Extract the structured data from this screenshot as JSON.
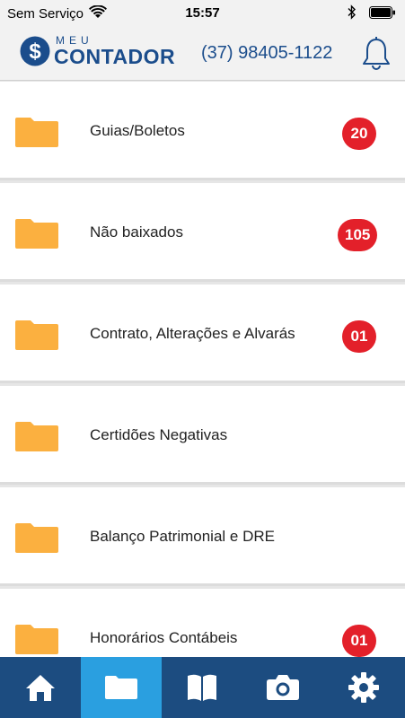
{
  "status_bar": {
    "carrier": "Sem Serviço",
    "time": "15:57"
  },
  "header": {
    "logo_small": "MEU",
    "logo_large": "CONTADOR",
    "phone": "(37) 98405-1122"
  },
  "folders": [
    {
      "label": "Guias/Boletos",
      "badge": "20"
    },
    {
      "label": "Não baixados",
      "badge": "105"
    },
    {
      "label": "Contrato, Alterações e Alvarás",
      "badge": "01"
    },
    {
      "label": "Certidões Negativas",
      "badge": ""
    },
    {
      "label": "Balanço Patrimonial e DRE",
      "badge": ""
    },
    {
      "label": "Honorários Contábeis",
      "badge": "01"
    }
  ],
  "tabbar": {
    "items": [
      "home-icon",
      "folder-icon",
      "book-icon",
      "camera-icon",
      "gear-icon"
    ],
    "active": 1
  },
  "colors": {
    "brand": "#1b4d8c",
    "tabbar": "#1c4c80",
    "tab_active": "#2a9fe0",
    "badge": "#e3202a",
    "folder": "#fbb040"
  }
}
